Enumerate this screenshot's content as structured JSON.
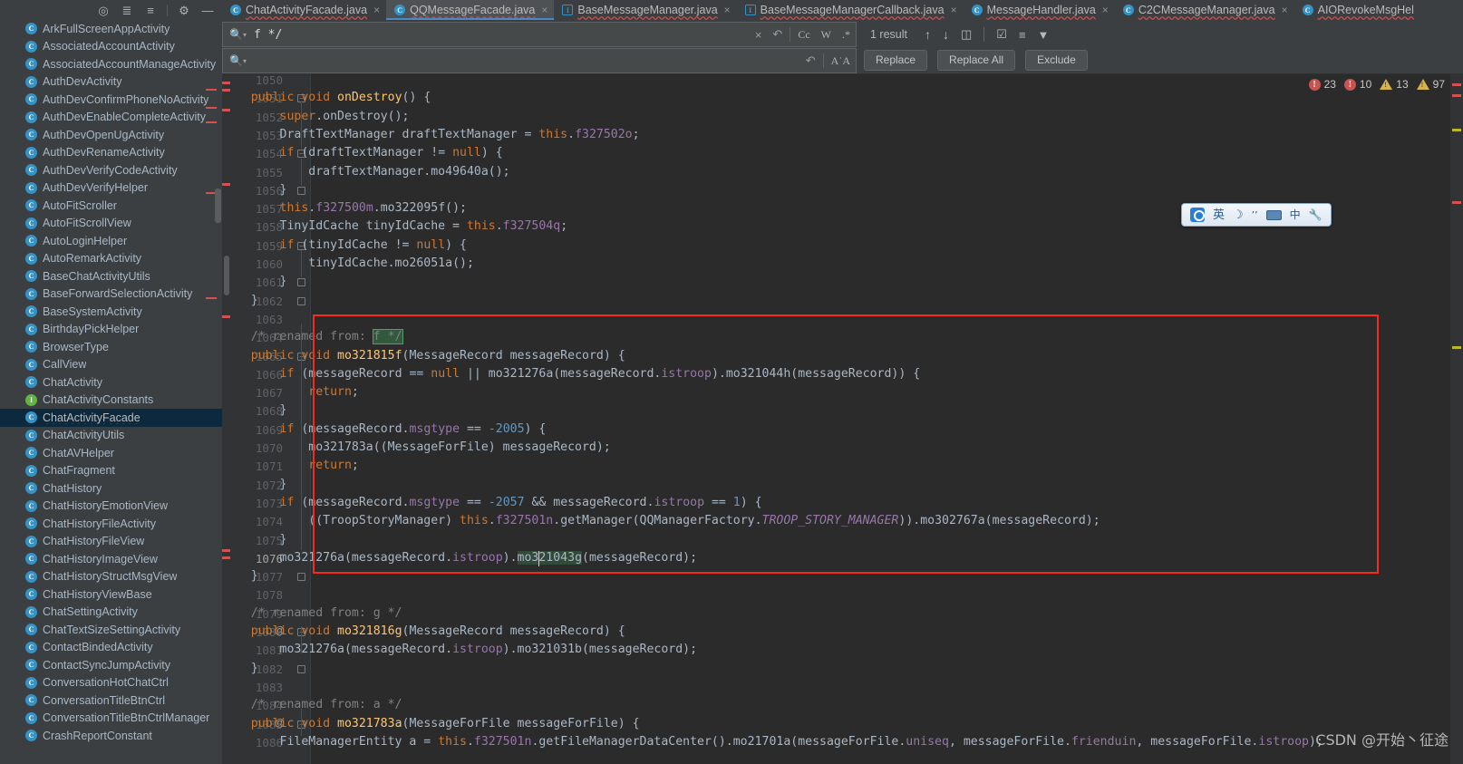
{
  "toolbar": {
    "icons": [
      {
        "name": "locate-icon",
        "glyph": "⊕"
      },
      {
        "name": "collapse-all-icon",
        "glyph": "≡"
      },
      {
        "name": "expand-all-icon",
        "glyph": "≣"
      },
      {
        "name": "settings-gear-icon",
        "glyph": "⚙"
      },
      {
        "name": "hide-panel-icon",
        "glyph": "—"
      }
    ]
  },
  "sidebar": {
    "selected": "ChatActivityFacade",
    "items": [
      {
        "label": "ArkFullScreenAppActivity",
        "kind": "C"
      },
      {
        "label": "AssociatedAccountActivity",
        "kind": "C"
      },
      {
        "label": "AssociatedAccountManageActivity",
        "kind": "C"
      },
      {
        "label": "AuthDevActivity",
        "kind": "C"
      },
      {
        "label": "AuthDevConfirmPhoneNoActivity",
        "kind": "C"
      },
      {
        "label": "AuthDevEnableCompleteActivity",
        "kind": "C"
      },
      {
        "label": "AuthDevOpenUgActivity",
        "kind": "C"
      },
      {
        "label": "AuthDevRenameActivity",
        "kind": "C"
      },
      {
        "label": "AuthDevVerifyCodeActivity",
        "kind": "C"
      },
      {
        "label": "AuthDevVerifyHelper",
        "kind": "C"
      },
      {
        "label": "AutoFitScroller",
        "kind": "C"
      },
      {
        "label": "AutoFitScrollView",
        "kind": "C"
      },
      {
        "label": "AutoLoginHelper",
        "kind": "C"
      },
      {
        "label": "AutoRemarkActivity",
        "kind": "C"
      },
      {
        "label": "BaseChatActivityUtils",
        "kind": "C"
      },
      {
        "label": "BaseForwardSelectionActivity",
        "kind": "C"
      },
      {
        "label": "BaseSystemActivity",
        "kind": "C"
      },
      {
        "label": "BirthdayPickHelper",
        "kind": "C"
      },
      {
        "label": "BrowserType",
        "kind": "C"
      },
      {
        "label": "CallView",
        "kind": "C"
      },
      {
        "label": "ChatActivity",
        "kind": "C"
      },
      {
        "label": "ChatActivityConstants",
        "kind": "I"
      },
      {
        "label": "ChatActivityFacade",
        "kind": "C"
      },
      {
        "label": "ChatActivityUtils",
        "kind": "C"
      },
      {
        "label": "ChatAVHelper",
        "kind": "C"
      },
      {
        "label": "ChatFragment",
        "kind": "C"
      },
      {
        "label": "ChatHistory",
        "kind": "C"
      },
      {
        "label": "ChatHistoryEmotionView",
        "kind": "C"
      },
      {
        "label": "ChatHistoryFileActivity",
        "kind": "C"
      },
      {
        "label": "ChatHistoryFileView",
        "kind": "C"
      },
      {
        "label": "ChatHistoryImageView",
        "kind": "C"
      },
      {
        "label": "ChatHistoryStructMsgView",
        "kind": "C"
      },
      {
        "label": "ChatHistoryViewBase",
        "kind": "C"
      },
      {
        "label": "ChatSettingActivity",
        "kind": "C"
      },
      {
        "label": "ChatTextSizeSettingActivity",
        "kind": "C"
      },
      {
        "label": "ContactBindedActivity",
        "kind": "C"
      },
      {
        "label": "ContactSyncJumpActivity",
        "kind": "C"
      },
      {
        "label": "ConversationHotChatCtrl",
        "kind": "C"
      },
      {
        "label": "ConversationTitleBtnCtrl",
        "kind": "C"
      },
      {
        "label": "ConversationTitleBtnCtrlManager",
        "kind": "C"
      },
      {
        "label": "CrashReportConstant",
        "kind": "C"
      }
    ]
  },
  "tabs": [
    {
      "label": "ChatActivityFacade.java",
      "kind": "C",
      "active": false
    },
    {
      "label": "QQMessageFacade.java",
      "kind": "C",
      "active": true
    },
    {
      "label": "BaseMessageManager.java",
      "kind": "I",
      "active": false
    },
    {
      "label": "BaseMessageManagerCallback.java",
      "kind": "I",
      "active": false
    },
    {
      "label": "MessageHandler.java",
      "kind": "C",
      "active": false
    },
    {
      "label": "C2CMessageManager.java",
      "kind": "C",
      "active": false
    },
    {
      "label": "AIORevokeMsgHel",
      "kind": "C",
      "active": false
    }
  ],
  "find": {
    "query": "f */",
    "replace_value": "",
    "replace_placeholder": "",
    "result_count": "1 result",
    "options": {
      "case": "Cc",
      "words": "W",
      "regex": ".*"
    },
    "buttons": {
      "replace": "Replace",
      "replace_all": "Replace All",
      "exclude": "Exclude"
    },
    "icons": {
      "search": "search-icon",
      "clear": "×",
      "history": "↶",
      "prev": "↑",
      "next": "↓",
      "select_all": "❐",
      "preserve_case": "A˙A",
      "filter": "filter-icon",
      "scope": "scope-icon",
      "open_in_find": "open-in-find-window-icon"
    }
  },
  "inspections": {
    "errors_1": "23",
    "errors_2": "10",
    "warnings_1": "13",
    "warnings_2": "97"
  },
  "editor": {
    "first_line": 1050,
    "current_line": 1076,
    "lines": [
      {
        "n": 1050,
        "text": "",
        "blank_top": true
      },
      {
        "n": 1051,
        "tokens": [
          [
            "pl",
            "    "
          ],
          [
            "k",
            "public void "
          ],
          [
            "f",
            "onDestroy"
          ],
          [
            "pl",
            "() {"
          ]
        ],
        "gutter": "override",
        "fold": "start"
      },
      {
        "n": 1052,
        "tokens": [
          [
            "pl",
            "        "
          ],
          [
            "k",
            "super"
          ],
          [
            "pl",
            ".onDestroy();"
          ]
        ]
      },
      {
        "n": 1053,
        "tokens": [
          [
            "pl",
            "        DraftTextManager draftTextManager = "
          ],
          [
            "k",
            "this"
          ],
          [
            "pl",
            "."
          ],
          [
            "fl",
            "f327502o"
          ],
          [
            "pl",
            ";"
          ]
        ]
      },
      {
        "n": 1054,
        "tokens": [
          [
            "pl",
            "        "
          ],
          [
            "k",
            "if"
          ],
          [
            "pl",
            " (draftTextManager != "
          ],
          [
            "k",
            "null"
          ],
          [
            "pl",
            ") {"
          ]
        ],
        "fold": "start"
      },
      {
        "n": 1055,
        "tokens": [
          [
            "pl",
            "            draftTextManager.mo49640a();"
          ]
        ]
      },
      {
        "n": 1056,
        "tokens": [
          [
            "pl",
            "        }"
          ]
        ],
        "fold": "end"
      },
      {
        "n": 1057,
        "tokens": [
          [
            "pl",
            "        "
          ],
          [
            "k",
            "this"
          ],
          [
            "pl",
            "."
          ],
          [
            "fl",
            "f327500m"
          ],
          [
            "pl",
            ".mo322095f();"
          ]
        ]
      },
      {
        "n": 1058,
        "tokens": [
          [
            "pl",
            "        TinyIdCache tinyIdCache = "
          ],
          [
            "k",
            "this"
          ],
          [
            "pl",
            "."
          ],
          [
            "fl",
            "f327504q"
          ],
          [
            "pl",
            ";"
          ]
        ]
      },
      {
        "n": 1059,
        "tokens": [
          [
            "pl",
            "        "
          ],
          [
            "k",
            "if"
          ],
          [
            "pl",
            " (tinyIdCache != "
          ],
          [
            "k",
            "null"
          ],
          [
            "pl",
            ") {"
          ]
        ],
        "fold": "start"
      },
      {
        "n": 1060,
        "tokens": [
          [
            "pl",
            "            tinyIdCache.mo26051a();"
          ]
        ]
      },
      {
        "n": 1061,
        "tokens": [
          [
            "pl",
            "        }"
          ]
        ],
        "fold": "end"
      },
      {
        "n": 1062,
        "tokens": [
          [
            "pl",
            "    }"
          ]
        ],
        "fold": "end"
      },
      {
        "n": 1063,
        "tokens": [
          [
            "pl",
            ""
          ]
        ]
      },
      {
        "n": 1064,
        "tokens": [
          [
            "cm",
            "    /* renamed from: "
          ],
          [
            "hl",
            "f */"
          ]
        ]
      },
      {
        "n": 1065,
        "tokens": [
          [
            "pl",
            "    "
          ],
          [
            "k",
            "public void "
          ],
          [
            "f",
            "mo321815f"
          ],
          [
            "pl",
            "(MessageRecord messageRecord) {"
          ]
        ],
        "fold": "start"
      },
      {
        "n": 1066,
        "tokens": [
          [
            "pl",
            "        "
          ],
          [
            "k",
            "if"
          ],
          [
            "pl",
            " (messageRecord == "
          ],
          [
            "k",
            "null"
          ],
          [
            "pl",
            " || mo321276a(messageRecord."
          ],
          [
            "fl",
            "istroop"
          ],
          [
            "pl",
            ").mo321044h(messageRecord)) {"
          ]
        ]
      },
      {
        "n": 1067,
        "tokens": [
          [
            "pl",
            "            "
          ],
          [
            "k",
            "return"
          ],
          [
            "pl",
            ";"
          ]
        ]
      },
      {
        "n": 1068,
        "tokens": [
          [
            "pl",
            "        }"
          ]
        ]
      },
      {
        "n": 1069,
        "tokens": [
          [
            "pl",
            "        "
          ],
          [
            "k",
            "if"
          ],
          [
            "pl",
            " (messageRecord."
          ],
          [
            "fl",
            "msgtype"
          ],
          [
            "pl",
            " == "
          ],
          [
            "n",
            "-2005"
          ],
          [
            "pl",
            ") {"
          ]
        ]
      },
      {
        "n": 1070,
        "tokens": [
          [
            "pl",
            "            mo321783a((MessageForFile) messageRecord);"
          ]
        ]
      },
      {
        "n": 1071,
        "tokens": [
          [
            "pl",
            "            "
          ],
          [
            "k",
            "return"
          ],
          [
            "pl",
            ";"
          ]
        ]
      },
      {
        "n": 1072,
        "tokens": [
          [
            "pl",
            "        }"
          ]
        ]
      },
      {
        "n": 1073,
        "tokens": [
          [
            "pl",
            "        "
          ],
          [
            "k",
            "if"
          ],
          [
            "pl",
            " (messageRecord."
          ],
          [
            "fl",
            "msgtype"
          ],
          [
            "pl",
            " == "
          ],
          [
            "n",
            "-2057"
          ],
          [
            "pl",
            " && messageRecord."
          ],
          [
            "fl",
            "istroop"
          ],
          [
            "pl",
            " == "
          ],
          [
            "n",
            "1"
          ],
          [
            "pl",
            ") {"
          ]
        ]
      },
      {
        "n": 1074,
        "tokens": [
          [
            "pl",
            "            ((TroopStoryManager) "
          ],
          [
            "k",
            "this"
          ],
          [
            "pl",
            "."
          ],
          [
            "fl",
            "f327501n"
          ],
          [
            "pl",
            ".getManager(QQManagerFactory."
          ],
          [
            "it",
            "TROOP_STORY_MANAGER"
          ],
          [
            "pl",
            ")).mo302767a(messageRecord);"
          ]
        ]
      },
      {
        "n": 1075,
        "tokens": [
          [
            "pl",
            "        }"
          ]
        ]
      },
      {
        "n": 1076,
        "tokens": [
          [
            "pl",
            "        mo321276a(messageRecord."
          ],
          [
            "fl",
            "istroop"
          ],
          [
            "pl",
            ")."
          ],
          [
            "soft",
            "mo321043g"
          ],
          [
            "pl",
            "(messageRecord);"
          ]
        ],
        "gutter": "warn",
        "current": true
      },
      {
        "n": 1077,
        "tokens": [
          [
            "pl",
            "    }"
          ]
        ],
        "fold": "end"
      },
      {
        "n": 1078,
        "tokens": [
          [
            "pl",
            ""
          ]
        ]
      },
      {
        "n": 1079,
        "tokens": [
          [
            "cm",
            "    /* renamed from: g */"
          ]
        ]
      },
      {
        "n": 1080,
        "tokens": [
          [
            "pl",
            "    "
          ],
          [
            "k",
            "public void "
          ],
          [
            "f",
            "mo321816g"
          ],
          [
            "pl",
            "(MessageRecord messageRecord) {"
          ]
        ],
        "gutter": "at",
        "fold": "start"
      },
      {
        "n": 1081,
        "tokens": [
          [
            "pl",
            "        mo321276a(messageRecord."
          ],
          [
            "fl",
            "istroop"
          ],
          [
            "pl",
            ").mo321031b(messageRecord);"
          ]
        ]
      },
      {
        "n": 1082,
        "tokens": [
          [
            "pl",
            "    }"
          ]
        ],
        "fold": "end"
      },
      {
        "n": 1083,
        "tokens": [
          [
            "pl",
            ""
          ]
        ]
      },
      {
        "n": 1084,
        "tokens": [
          [
            "cm",
            "    /* renamed from: a */"
          ]
        ]
      },
      {
        "n": 1085,
        "tokens": [
          [
            "pl",
            "    "
          ],
          [
            "k",
            "public void "
          ],
          [
            "f",
            "mo321783a"
          ],
          [
            "pl",
            "(MessageForFile messageForFile) {"
          ]
        ],
        "gutter": "at",
        "fold": "start"
      },
      {
        "n": 1086,
        "tokens": [
          [
            "pl",
            "        FileManagerEntity a = "
          ],
          [
            "k",
            "this"
          ],
          [
            "pl",
            "."
          ],
          [
            "fl",
            "f327501n"
          ],
          [
            "pl",
            ".getFileManagerDataCenter().mo21701a(messageForFile."
          ],
          [
            "fl",
            "uniseq"
          ],
          [
            "pl",
            ", messageForFile."
          ],
          [
            "fl",
            "frienduin"
          ],
          [
            "pl",
            ", messageForFile."
          ],
          [
            "fl",
            "istroop"
          ],
          [
            "pl",
            ");"
          ]
        ]
      }
    ]
  },
  "ime": {
    "items": [
      {
        "name": "ime-logo-icon",
        "glyph": ""
      },
      {
        "name": "ime-language-mode",
        "glyph": "英"
      },
      {
        "name": "ime-moon-icon",
        "glyph": "☽"
      },
      {
        "name": "ime-punctuation-icon",
        "glyph": "’’"
      },
      {
        "name": "ime-keyboard-icon",
        "glyph": ""
      },
      {
        "name": "ime-handwriting-icon",
        "glyph": "中"
      },
      {
        "name": "ime-toolbox-icon",
        "glyph": "🔧"
      }
    ]
  },
  "watermark": "CSDN @开始丶征途"
}
